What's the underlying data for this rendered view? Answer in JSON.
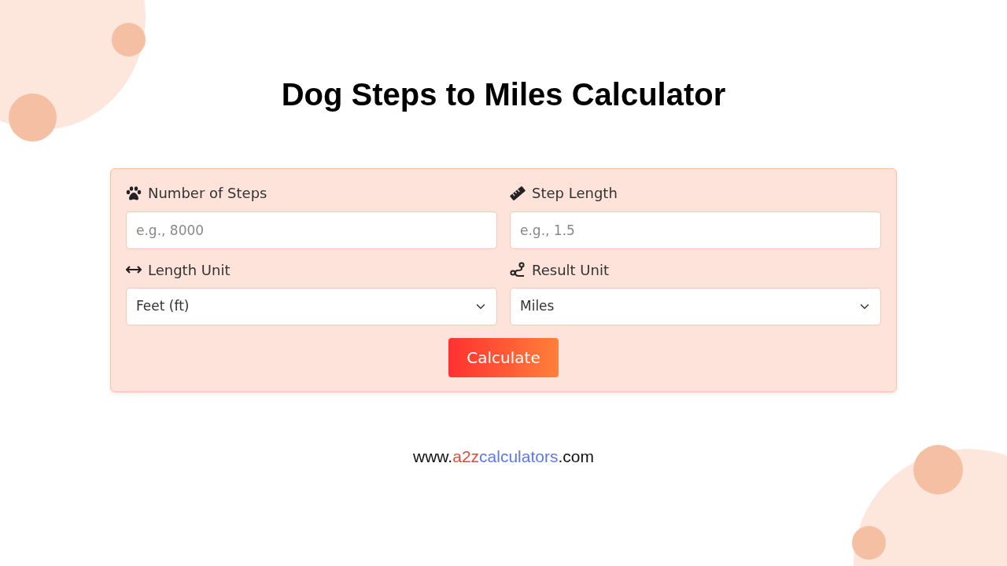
{
  "title": "Dog Steps to Miles Calculator",
  "fields": [
    {
      "label": "Number of Steps",
      "kind": "input",
      "placeholder": "e.g., 8000"
    },
    {
      "label": "Step Length",
      "kind": "input",
      "placeholder": "e.g., 1.5"
    },
    {
      "label": "Length Unit",
      "kind": "select",
      "value": "Feet (ft)"
    },
    {
      "label": "Result Unit",
      "kind": "select",
      "value": "Miles"
    }
  ],
  "button": "Calculate",
  "footer": [
    {
      "text": "www.",
      "color": "#111111"
    },
    {
      "text": "a2z",
      "color": "#f0433a"
    },
    {
      "text": "calculators",
      "color": "#5b78f0"
    },
    {
      "text": ".com",
      "color": "#111111"
    }
  ]
}
